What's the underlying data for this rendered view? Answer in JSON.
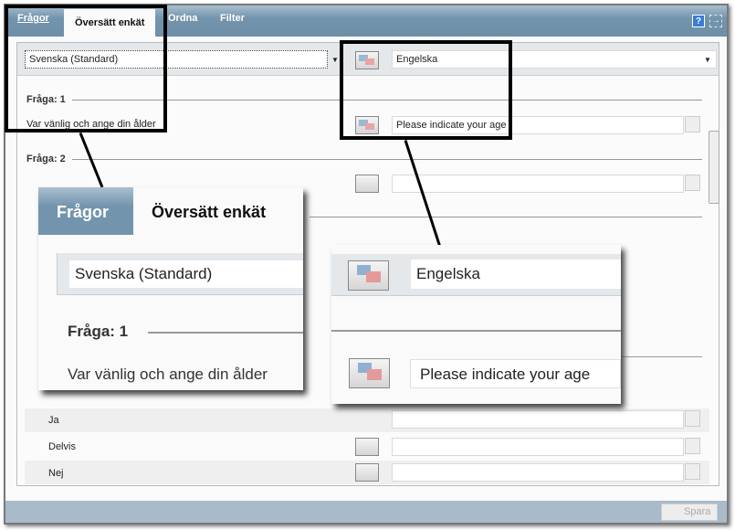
{
  "tabs": [
    {
      "label": "Frågor",
      "state": "link"
    },
    {
      "label": "Översätt enkät",
      "state": "active"
    },
    {
      "label": "Ordna"
    },
    {
      "label": "Filter"
    }
  ],
  "toolbar": {
    "help_icon": "?",
    "exit_icon": "exit-icon"
  },
  "source_language": {
    "value": "Svenska (Standard)"
  },
  "target_language": {
    "value": "Engelska"
  },
  "questions": [
    {
      "header": "Fråga: 1",
      "text": "Var vänlig och ange din ålder",
      "translation": "Please indicate your age"
    },
    {
      "header": "Fråga: 2",
      "text": "",
      "translation": ""
    }
  ],
  "answers": [
    {
      "text": "Ja",
      "translation": ""
    },
    {
      "text": "Delvis",
      "translation": ""
    },
    {
      "text": "Nej",
      "translation": ""
    }
  ],
  "save_label": "Spara",
  "callout_left": {
    "tab1": "Frågor",
    "tab2": "Översätt enkät",
    "language": "Svenska (Standard)",
    "header": "Fråga: 1",
    "text": "Var vänlig och ange din ålder"
  },
  "callout_right": {
    "language": "Engelska",
    "translation": "Please indicate your age"
  },
  "colors": {
    "tabbar": "#7394ad",
    "bottom": "#a9bbca",
    "help": "#3a7bd5"
  }
}
